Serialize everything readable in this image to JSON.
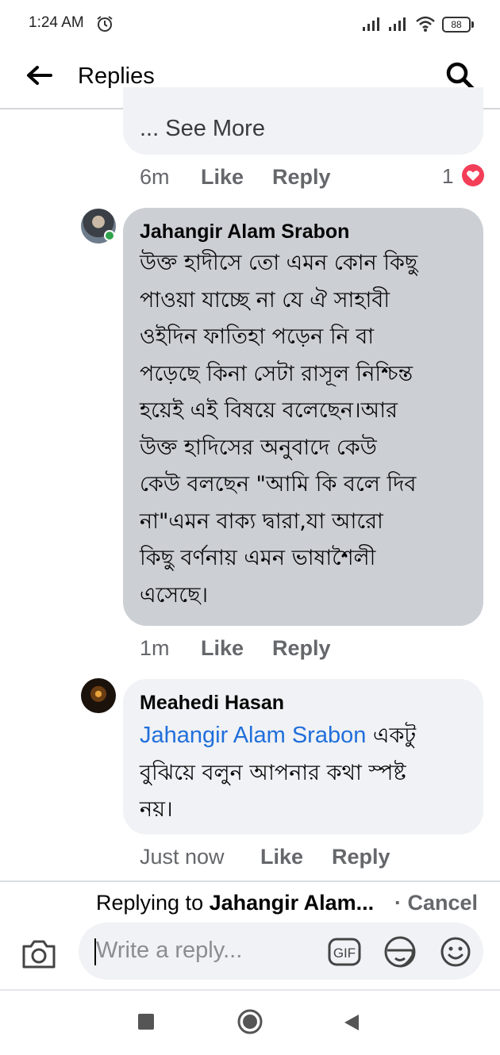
{
  "status_bar": {
    "time": "1:24 AM",
    "battery": "88"
  },
  "header": {
    "title": "Replies"
  },
  "previous_comment": {
    "see_more": "... See More",
    "time": "6m",
    "like_label": "Like",
    "reply_label": "Reply",
    "reaction_count": "1"
  },
  "comments": [
    {
      "author": "Jahangir Alam Srabon",
      "body": "উক্ত হাদীসে তো এমন কোন কিছু\nপাওয়া যাচ্ছে না যে ঐ সাহাবী\nওইদিন ফাতিহা পড়েন নি বা\nপড়েছে কিনা সেটা রাসূল নিশ্চিন্ত\nহয়েই এই বিষয়ে বলেছেন।আর\nউক্ত হাদিসের অনুবাদে কেউ\nকেউ বলছেন \"আমি কি বলে দিব\nনা\"এমন বাক্য দ্বারা,যা আরো\nকিছু বর্ণনায় এমন ভাষাশৈলী\nএসেছে।",
      "time": "1m",
      "like_label": "Like",
      "reply_label": "Reply"
    },
    {
      "author": "Meahedi Hasan",
      "mention": "Jahangir Alam Srabon",
      "body_first": " একটু",
      "body_rest": "বুঝিয়ে বলুন আপনার কথা স্পষ্ট\nনয়।",
      "time": "Just now",
      "like_label": "Like",
      "reply_label": "Reply"
    }
  ],
  "composer": {
    "replying_prefix": "Replying to ",
    "replying_name": "Jahangir Alam...",
    "cancel_label": " · Cancel",
    "placeholder": "Write a reply..."
  },
  "colors": {
    "mention": "#216fdb",
    "meta": "#65676b",
    "bubble": "#f0f2f5",
    "bubble_selected": "#ccd0d5",
    "heart": "#f33e58",
    "online": "#31a24c"
  }
}
